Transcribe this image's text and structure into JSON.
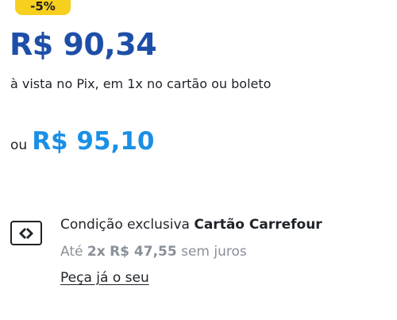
{
  "badge": {
    "discount": "-5%",
    "color": "#f7cf1e"
  },
  "pricing": {
    "pix_price": "R$ 90,34",
    "pix_price_color": "#1e4fa8",
    "payment_note": "à vista no Pix, em 1x no cartão ou boleto",
    "alt_prefix": "ou",
    "alt_price": "R$ 95,10",
    "alt_price_color": "#1a8fe6"
  },
  "card_offer": {
    "icon": "carrefour-card-icon",
    "title_prefix": "Condição exclusiva",
    "title_brand": "Cartão Carrefour",
    "installment_prefix": "Até",
    "installment_count": "2x",
    "installment_value": "R$ 47,55",
    "installment_suffix": "sem juros",
    "cta": "Peça já o seu"
  }
}
